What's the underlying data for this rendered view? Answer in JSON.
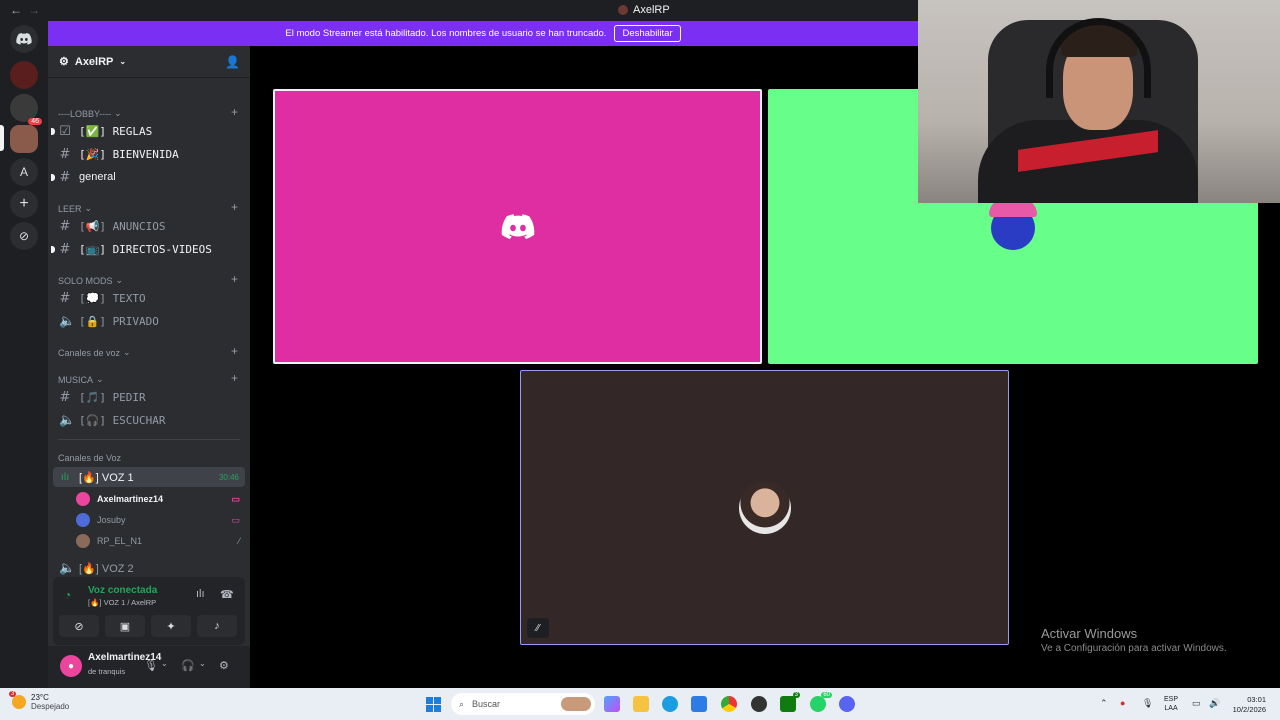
{
  "window": {
    "title": "AxelRP",
    "back": "←",
    "forward": "→"
  },
  "banner": {
    "text": "El modo Streamer está habilitado. Los nombres de usuario se han truncado.",
    "button": "Deshabilitar"
  },
  "rail": {
    "badge": "46",
    "letter": "A"
  },
  "server": {
    "name": "AxelRP"
  },
  "categories": {
    "lobby": "----LOBBY----",
    "leer": "LEER",
    "solomods": "SOLO MODS",
    "canales_voz": "Canales de voz",
    "musica": "MUSICA",
    "canales_Voz": "Canales de Voz"
  },
  "channels": {
    "reglas": "[✅] REGLAS",
    "bienvenida": "[🎉] BIENVENIDA",
    "general": "general",
    "anuncios": "[📢] ANUNCIOS",
    "directos": "[📺] DIRECTOS-VIDEOS",
    "texto": "[💭] TEXTO",
    "privado": "[🔒] PRIVADO",
    "pedir": "[🎵] PEDIR",
    "escuchar": "[🎧] ESCUCHAR",
    "voz1": "[🔥] VOZ 1",
    "voz1_timer": "30:46",
    "voz2": "[🔥] VOZ 2"
  },
  "voice_users": [
    "Axelmartinez14",
    "Josuby",
    "RP_EL_N1"
  ],
  "voice_panel": {
    "status": "Voz conectada",
    "sub": "[🔥] VOZ 1 / AxelRP"
  },
  "user_panel": {
    "name": "Axelmartinez14",
    "status": "de tranquis"
  },
  "watermark": {
    "line1": "Activar Windows",
    "line2": "Ve a Configuración para activar Windows."
  },
  "taskbar": {
    "weather_temp": "23°C",
    "weather_desc": "Despejado",
    "weather_badge": "3",
    "search_placeholder": "Buscar",
    "lang1": "ESP",
    "lang2": "LAA",
    "time": "03:01",
    "date": "10/2/2026",
    "badge_xbox": "3",
    "badge_whatsapp": "60"
  },
  "colors": {
    "banner": "#7b2ff2",
    "tile1": "#df2ea1",
    "tile2": "#68fe8a",
    "tile3": "#332728",
    "voice_green": "#23a55a"
  }
}
